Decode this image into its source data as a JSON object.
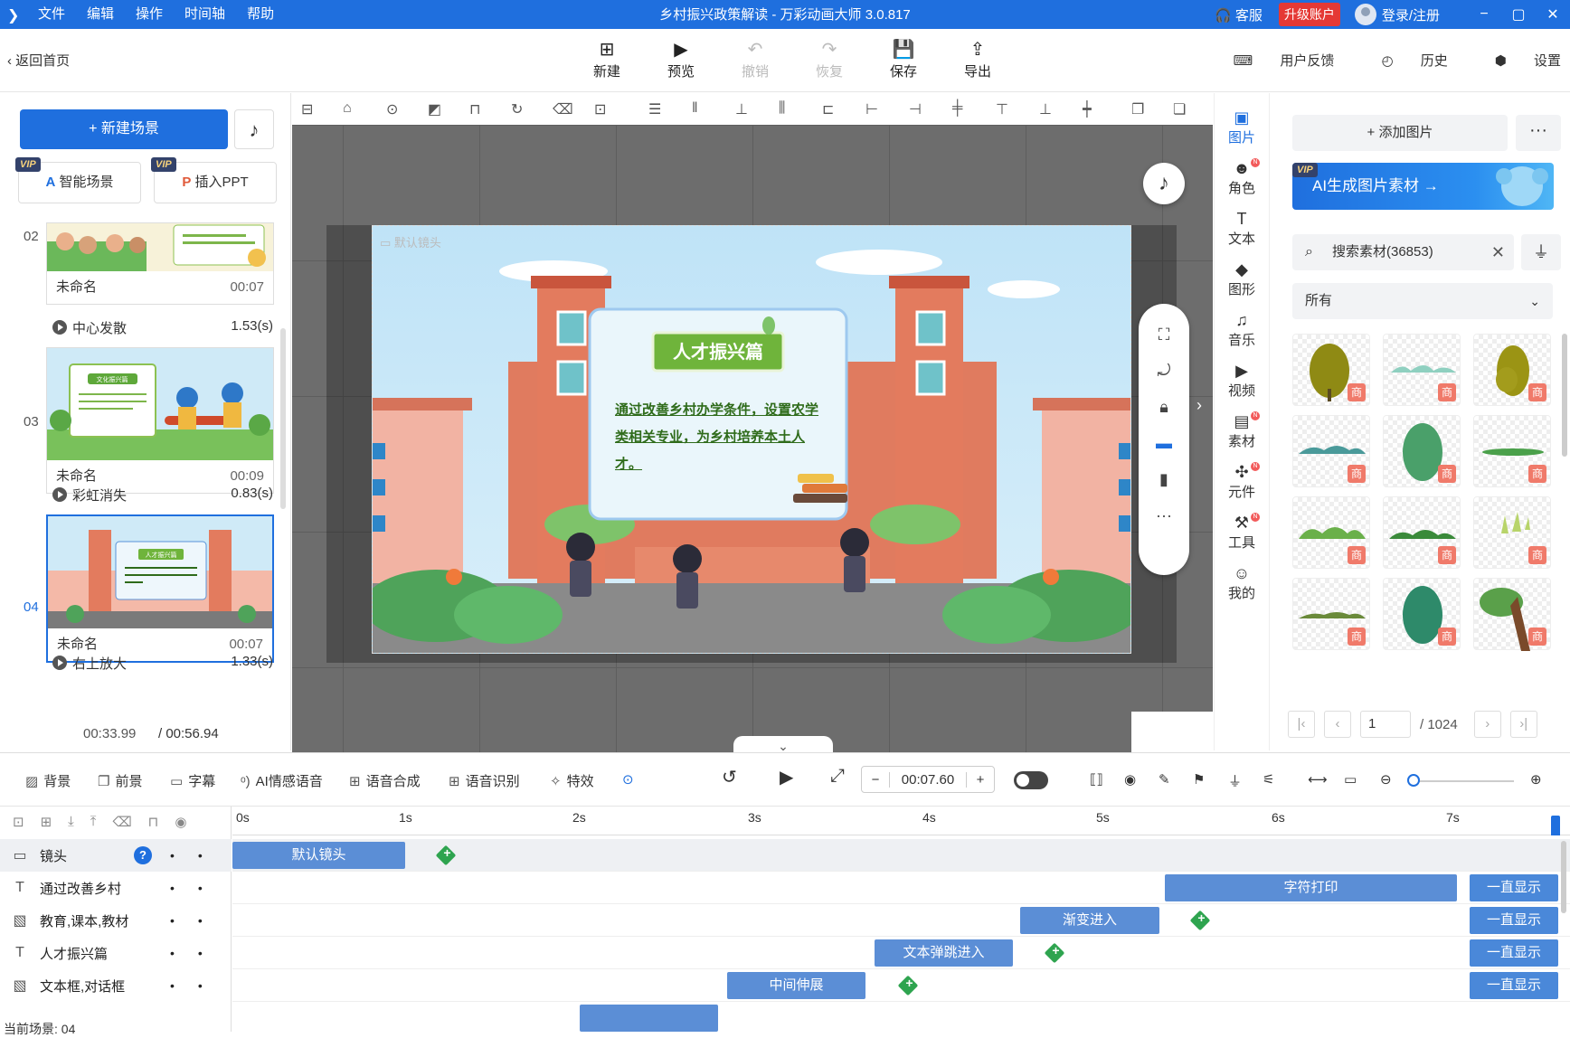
{
  "titlebar": {
    "menu": [
      "文件",
      "编辑",
      "操作",
      "时间轴",
      "帮助"
    ],
    "title": "乡村振兴政策解读 - 万彩动画大师 3.0.817",
    "service": "客服",
    "upgrade": "升级账户",
    "login": "登录/注册",
    "min": "−",
    "max": "▢",
    "close": "✕"
  },
  "toolbar": {
    "back": "返回首页",
    "tools": [
      {
        "label": "新建",
        "icon": "new-icon",
        "glyph": "⊞"
      },
      {
        "label": "预览",
        "icon": "preview-icon",
        "glyph": "▶"
      },
      {
        "label": "撤销",
        "icon": "undo-icon",
        "glyph": "↶"
      },
      {
        "label": "恢复",
        "icon": "redo-icon",
        "glyph": "↷"
      },
      {
        "label": "保存",
        "icon": "save-icon",
        "glyph": "💾"
      },
      {
        "label": "导出",
        "icon": "export-icon",
        "glyph": "⇪"
      }
    ],
    "feedback": "用户反馈",
    "history": "历史",
    "settings": "设置"
  },
  "left": {
    "new_scene": "+ 新建场景",
    "vip": "VIP",
    "smart_scene": "智能场景",
    "insert_ppt": "插入PPT",
    "scenes": [
      {
        "num": "02",
        "name": "未命名",
        "dur": "00:07",
        "trans": "中心发散",
        "trans_dur": "1.53(s)"
      },
      {
        "num": "03",
        "name": "未命名",
        "dur": "00:09",
        "trans": "彩虹消失",
        "trans_dur": "0.83(s)"
      },
      {
        "num": "04",
        "name": "未命名",
        "dur": "00:07",
        "trans": "右上放大",
        "trans_dur": "1.33(s)"
      }
    ],
    "current_time": "00:33.99",
    "total_time": "/ 00:56.94"
  },
  "canvas": {
    "camera_label": "默认镜头",
    "card_title": "人才振兴篇",
    "card_text": "通过改善乡村办学条件，设置农学类相关专业，为乡村培养本土人才。",
    "thumb_title_03": "文化振兴篇",
    "thumb_title_04": "人才振兴篇"
  },
  "righttabs": [
    {
      "label": "图片",
      "glyph": "▣",
      "badge": false
    },
    {
      "label": "角色",
      "glyph": "☻",
      "badge": true
    },
    {
      "label": "文本",
      "glyph": "T",
      "badge": false
    },
    {
      "label": "图形",
      "glyph": "◆",
      "badge": false
    },
    {
      "label": "音乐",
      "glyph": "♫",
      "badge": false
    },
    {
      "label": "视频",
      "glyph": "▶",
      "badge": false
    },
    {
      "label": "素材",
      "glyph": "▤",
      "badge": true
    },
    {
      "label": "元件",
      "glyph": "✣",
      "badge": true
    },
    {
      "label": "工具",
      "glyph": "⚒",
      "badge": true
    },
    {
      "label": "我的",
      "glyph": "☺",
      "badge": false
    }
  ],
  "right": {
    "add_pic": "+ 添加图片",
    "more": "···",
    "ai_banner": "AI生成图片素材 →",
    "search_value": "搜索素材(36853)",
    "select_value": "所有",
    "shang": "商",
    "page": "1",
    "total_pages": "/ 1024"
  },
  "timeline": {
    "tools": [
      "背景",
      "前景",
      "字幕",
      "AI情感语音",
      "语音合成",
      "语音识别",
      "特效"
    ],
    "time": "00:07.60",
    "ticks": [
      "0s",
      "1s",
      "2s",
      "3s",
      "4s",
      "5s",
      "6s",
      "7s"
    ],
    "tracks": [
      {
        "icon": "camera-icon",
        "glyph": "▭",
        "name": "镜头"
      },
      {
        "icon": "text-icon",
        "glyph": "T",
        "name": "通过改善乡村"
      },
      {
        "icon": "image-icon",
        "glyph": "▧",
        "name": "教育,课本,教材"
      },
      {
        "icon": "text-icon",
        "glyph": "T",
        "name": "人才振兴篇"
      },
      {
        "icon": "image-icon",
        "glyph": "▧",
        "name": "文本框,对话框"
      }
    ],
    "clips": {
      "camera": "默认镜头",
      "typing": "字符打印",
      "fade_in": "渐变进入",
      "bounce_in": "文本弹跳进入",
      "middle_stretch": "中间伸展",
      "always": "一直显示"
    },
    "current_scene": "当前场景: 04"
  }
}
